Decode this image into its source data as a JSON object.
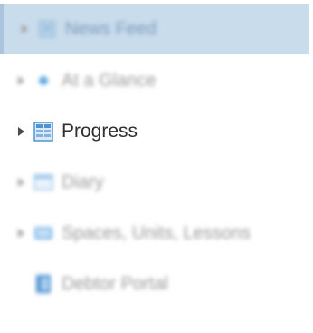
{
  "nav": {
    "items": [
      {
        "label": "News Feed",
        "icon": "newspaper-icon",
        "expandable": true,
        "selected": true
      },
      {
        "label": "At a Glance",
        "icon": "glance-star-icon",
        "expandable": true,
        "selected": false
      },
      {
        "label": "Progress",
        "icon": "progress-table-icon",
        "expandable": true,
        "selected": false
      },
      {
        "label": "Diary",
        "icon": "calendar-icon",
        "expandable": true,
        "selected": false
      },
      {
        "label": "Spaces, Units, Lessons",
        "icon": "folder-icon",
        "expandable": true,
        "selected": false
      },
      {
        "label": "Debtor Portal",
        "icon": "portal-book-icon",
        "expandable": false,
        "selected": false
      }
    ]
  },
  "colors": {
    "selected_background": "#c9dcec",
    "selected_text": "#7c9cbc",
    "icon_blue": "#5fa8e0",
    "active_text": "#2f2f2f"
  }
}
